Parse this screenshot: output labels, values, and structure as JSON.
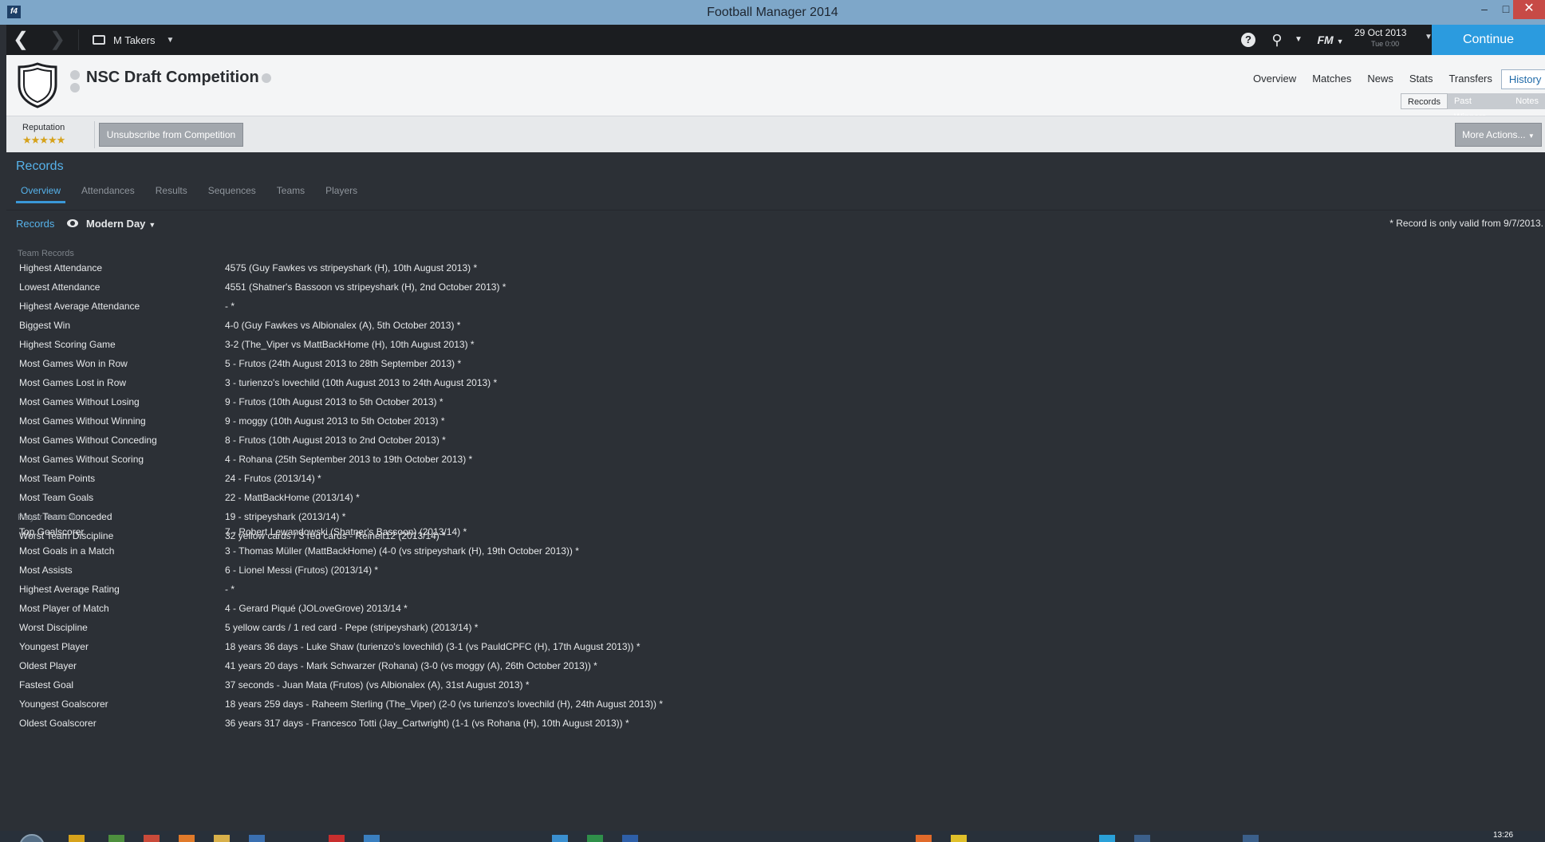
{
  "window": {
    "title": "Football Manager 2014"
  },
  "nav": {
    "manager": "M Takers",
    "date": "29 Oct 2013",
    "time": "Tue 0:00",
    "continue": "Continue",
    "fm_logo": "FM"
  },
  "header": {
    "title": "NSC Draft Competition",
    "tabs": [
      "Overview",
      "Matches",
      "News",
      "Stats",
      "Transfers",
      "History"
    ],
    "subtabs": [
      "Records",
      "Past Winners",
      "Notes"
    ]
  },
  "toolbar": {
    "reputation_label": "Reputation",
    "unsubscribe": "Unsubscribe from Competition",
    "more_actions": "More Actions..."
  },
  "records": {
    "title": "Records",
    "tabs": [
      "Overview",
      "Attendances",
      "Results",
      "Sequences",
      "Teams",
      "Players"
    ],
    "view_label": "Records",
    "era": "Modern Day",
    "note": "* Record is only valid from 9/7/2013.",
    "team_title": "Team Records",
    "team": [
      [
        "Highest Attendance",
        "4575 (Guy Fawkes vs stripeyshark (H), 10th August 2013) *"
      ],
      [
        "Lowest Attendance",
        "4551 (Shatner's Bassoon vs stripeyshark (H), 2nd October 2013) *"
      ],
      [
        "Highest Average Attendance",
        "- *"
      ],
      [
        "Biggest Win",
        "4-0 (Guy Fawkes vs Albionalex (A), 5th October 2013) *"
      ],
      [
        "Highest Scoring Game",
        "3-2 (The_Viper vs MattBackHome (H), 10th August 2013) *"
      ],
      [
        "Most Games Won in Row",
        "5 - Frutos (24th August 2013 to 28th September 2013) *"
      ],
      [
        "Most Games Lost in Row",
        "3 - turienzo's lovechild (10th August 2013 to 24th August 2013) *"
      ],
      [
        "Most Games Without Losing",
        "9 - Frutos (10th August 2013 to 5th October 2013) *"
      ],
      [
        "Most Games Without Winning",
        "9 - moggy (10th August 2013 to 5th October 2013) *"
      ],
      [
        "Most Games Without Conceding",
        "8 - Frutos (10th August 2013 to 2nd October 2013) *"
      ],
      [
        "Most Games Without Scoring",
        "4 - Rohana (25th September 2013 to 19th October 2013) *"
      ],
      [
        "Most Team Points",
        "24 - Frutos (2013/14) *"
      ],
      [
        "Most Team Goals",
        "22 - MattBackHome (2013/14) *"
      ],
      [
        "Most Team Conceded",
        "19 - stripeyshark (2013/14) *"
      ],
      [
        "Worst Team Discipline",
        "32 yellow cards / 3 red cards - Reinelt12 (2013/14) *"
      ]
    ],
    "player_title": "Player Records",
    "player": [
      [
        "Top Goalscorer",
        "7 - Robert Lewandowski (Shatner's Bassoon) (2013/14) *"
      ],
      [
        "Most Goals in a Match",
        "3 - Thomas Müller (MattBackHome) (4-0 (vs stripeyshark (H), 19th October 2013)) *"
      ],
      [
        "Most Assists",
        "6 - Lionel Messi (Frutos) (2013/14) *"
      ],
      [
        "Highest Average Rating",
        "- *"
      ],
      [
        "Most Player of Match",
        "4 - Gerard Piqué (JOLoveGrove) 2013/14 *"
      ],
      [
        "Worst Discipline",
        "5 yellow cards / 1 red card - Pepe (stripeyshark) (2013/14) *"
      ],
      [
        "Youngest Player",
        "18 years 36 days - Luke Shaw (turienzo's lovechild) (3-1 (vs PauldCPFC (H), 17th August 2013)) *"
      ],
      [
        "Oldest Player",
        "41 years 20 days - Mark Schwarzer (Rohana) (3-0 (vs moggy (A), 26th October 2013)) *"
      ],
      [
        "Fastest Goal",
        "37 seconds - Juan Mata (Frutos) (vs Albionalex (A), 31st August 2013) *"
      ],
      [
        "Youngest Goalscorer",
        "18 years 259 days - Raheem Sterling (The_Viper) (2-0 (vs turienzo's lovechild (H), 24th August 2013)) *"
      ],
      [
        "Oldest Goalscorer",
        "36 years 317 days - Francesco Totti (Jay_Cartwright) (1-1 (vs Rohana (H), 10th August 2013)) *"
      ]
    ]
  },
  "taskbar": {
    "clock": "13:26"
  },
  "colors": {
    "accent": "#2b9bdf",
    "link": "#56b2ea",
    "background": "#2c3036",
    "header": "#f4f5f6",
    "star": "#d6a21b"
  }
}
